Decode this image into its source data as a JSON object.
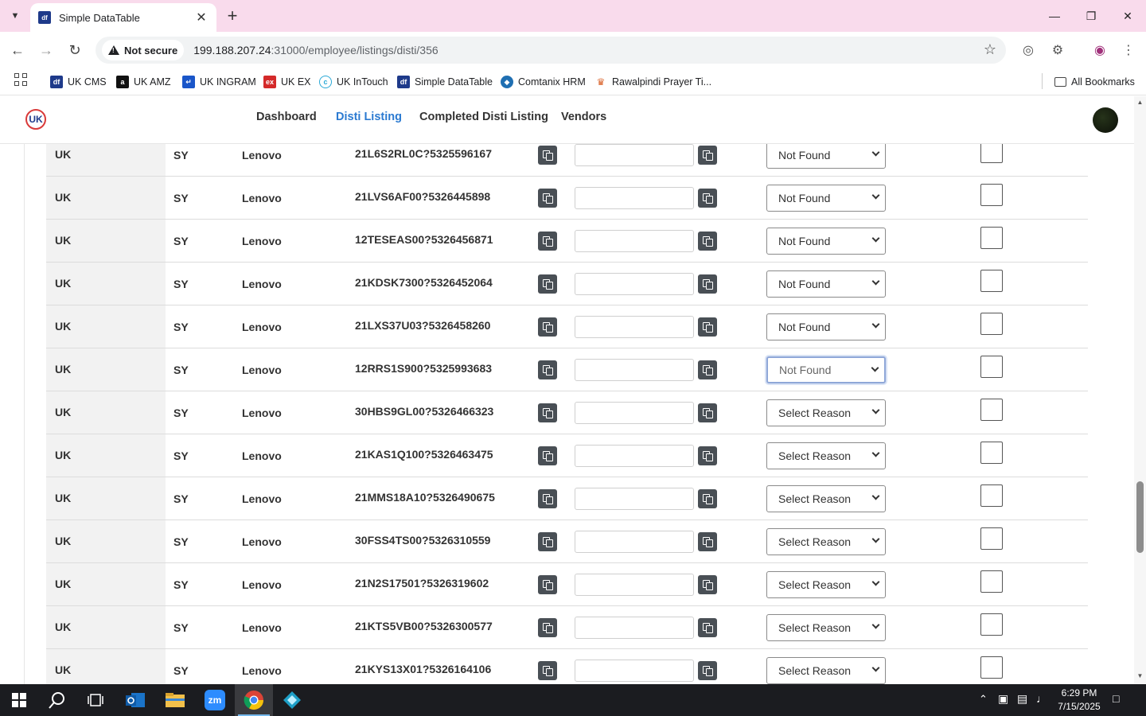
{
  "browser": {
    "tab_title": "Simple DataTable",
    "favicon_text": "df",
    "not_secure_label": "Not secure",
    "url_host": "199.188.207.24",
    "url_rest": ":31000/employee/listings/disti/356",
    "bookmarks": [
      {
        "label": "UK CMS",
        "icon": "df-icon",
        "color": "#1e3a8a"
      },
      {
        "label": "UK AMZ",
        "icon": "amazon-icon",
        "color": "#111111"
      },
      {
        "label": "UK INGRAM",
        "icon": "ingram-icon",
        "color": "#1a56c9"
      },
      {
        "label": "UK EX",
        "icon": "ex-icon",
        "color": "#d42a2a"
      },
      {
        "label": "UK InTouch",
        "icon": "intouch-icon",
        "color": "#2aa9d6"
      },
      {
        "label": "Simple DataTable",
        "icon": "df-icon",
        "color": "#1e3a8a"
      },
      {
        "label": "Comtanix HRM",
        "icon": "comtanix-icon",
        "color": "#1f6fb2"
      },
      {
        "label": "Rawalpindi Prayer Ti...",
        "icon": "prayer-icon",
        "color": "#d9622a"
      }
    ],
    "all_bookmarks_label": "All Bookmarks"
  },
  "nav": {
    "logo_text": "UK",
    "links": [
      "Dashboard",
      "Disti Listing",
      "Completed Disti Listing",
      "Vendors"
    ],
    "active_index": 1
  },
  "table": {
    "rows": [
      {
        "country": "UK",
        "code": "SY",
        "brand": "Lenovo",
        "sku": "21L6S2RL0C?5325596167",
        "tin": "",
        "reason": "Not Found",
        "checked": false
      },
      {
        "country": "UK",
        "code": "SY",
        "brand": "Lenovo",
        "sku": "21LVS6AF00?5326445898",
        "tin": "",
        "reason": "Not Found",
        "checked": false
      },
      {
        "country": "UK",
        "code": "SY",
        "brand": "Lenovo",
        "sku": "12TESEAS00?5326456871",
        "tin": "",
        "reason": "Not Found",
        "checked": false
      },
      {
        "country": "UK",
        "code": "SY",
        "brand": "Lenovo",
        "sku": "21KDSK7300?5326452064",
        "tin": "",
        "reason": "Not Found",
        "checked": false
      },
      {
        "country": "UK",
        "code": "SY",
        "brand": "Lenovo",
        "sku": "21LXS37U03?5326458260",
        "tin": "",
        "reason": "Not Found",
        "checked": false
      },
      {
        "country": "UK",
        "code": "SY",
        "brand": "Lenovo",
        "sku": "12RRS1S900?5325993683",
        "tin": "",
        "reason": "Not Found",
        "checked": false,
        "focused": true
      },
      {
        "country": "UK",
        "code": "SY",
        "brand": "Lenovo",
        "sku": "30HBS9GL00?5326466323",
        "tin": "",
        "reason": "Select Reason",
        "checked": false
      },
      {
        "country": "UK",
        "code": "SY",
        "brand": "Lenovo",
        "sku": "21KAS1Q100?5326463475",
        "tin": "",
        "reason": "Select Reason",
        "checked": false
      },
      {
        "country": "UK",
        "code": "SY",
        "brand": "Lenovo",
        "sku": "21MMS18A10?5326490675",
        "tin": "",
        "reason": "Select Reason",
        "checked": false
      },
      {
        "country": "UK",
        "code": "SY",
        "brand": "Lenovo",
        "sku": "30FSS4TS00?5326310559",
        "tin": "",
        "reason": "Select Reason",
        "checked": false
      },
      {
        "country": "UK",
        "code": "SY",
        "brand": "Lenovo",
        "sku": "21N2S17501?5326319602",
        "tin": "",
        "reason": "Select Reason",
        "checked": false
      },
      {
        "country": "UK",
        "code": "SY",
        "brand": "Lenovo",
        "sku": "21KTS5VB00?5326300577",
        "tin": "",
        "reason": "Select Reason",
        "checked": false
      },
      {
        "country": "UK",
        "code": "SY",
        "brand": "Lenovo",
        "sku": "21KYS13X01?5326164106",
        "tin": "",
        "reason": "Select Reason",
        "checked": false
      }
    ]
  },
  "taskbar": {
    "time": "6:29 PM",
    "date": "7/15/2025",
    "apps": [
      "start-icon",
      "search-icon",
      "task-view-icon",
      "outlook-icon",
      "file-explorer-icon",
      "zoom-icon",
      "chrome-icon",
      "app-icon"
    ],
    "zoom_label": "zm"
  },
  "colors": {
    "tabbar_bg": "#f9dbec",
    "active_nav": "#2b7ad1",
    "copy_button": "#494f55",
    "taskbar_bg": "#1b1c20"
  }
}
